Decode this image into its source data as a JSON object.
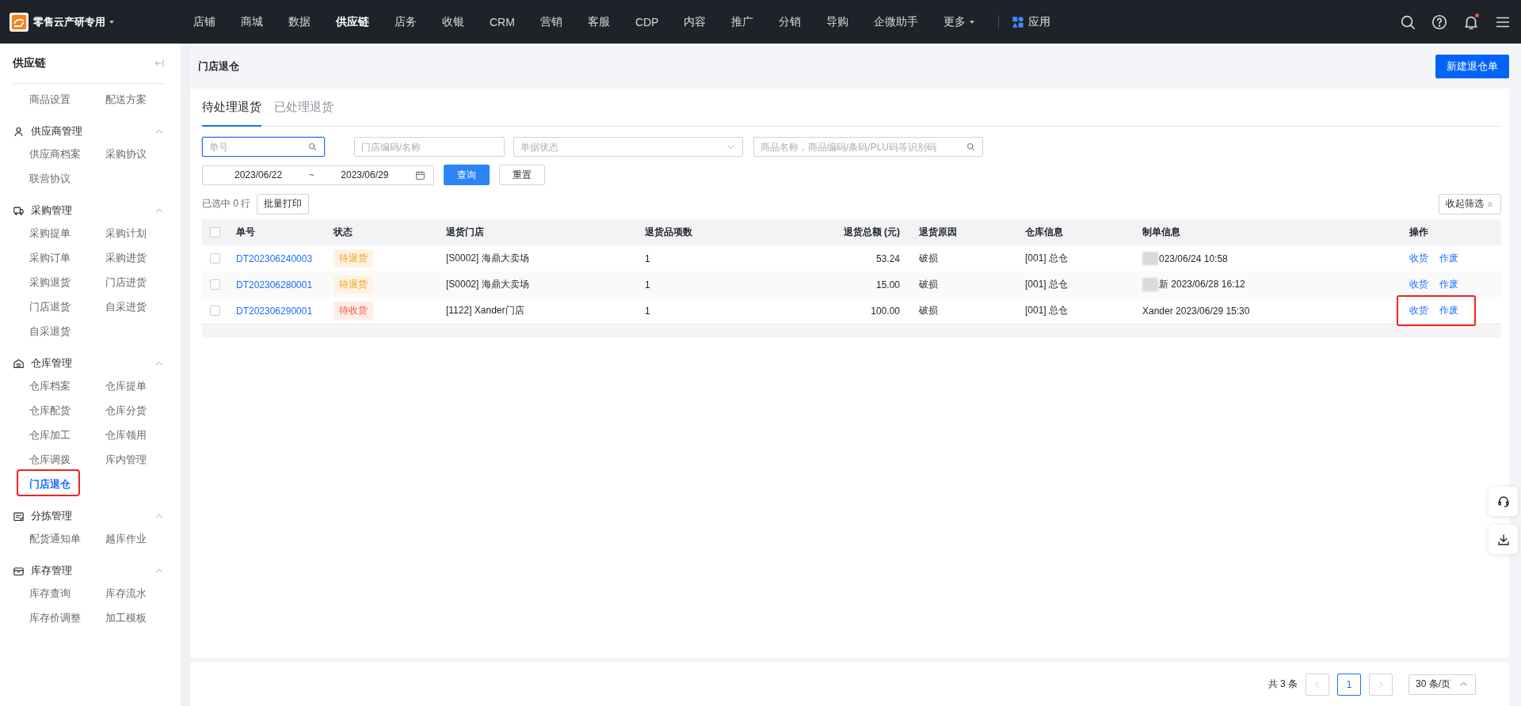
{
  "brand": {
    "name": "零售云产研专用"
  },
  "nav": [
    {
      "label": "店铺",
      "selected": false
    },
    {
      "label": "商城",
      "selected": false
    },
    {
      "label": "数据",
      "selected": false
    },
    {
      "label": "供应链",
      "selected": true
    },
    {
      "label": "店务",
      "selected": false
    },
    {
      "label": "收银",
      "selected": false
    },
    {
      "label": "CRM",
      "selected": false
    },
    {
      "label": "营销",
      "selected": false
    },
    {
      "label": "客服",
      "selected": false
    },
    {
      "label": "CDP",
      "selected": false
    },
    {
      "label": "内容",
      "selected": false
    },
    {
      "label": "推广",
      "selected": false
    },
    {
      "label": "分销",
      "selected": false
    },
    {
      "label": "导购",
      "selected": false
    },
    {
      "label": "企微助手",
      "selected": false
    },
    {
      "label": "更多",
      "selected": false,
      "kind": "menu"
    }
  ],
  "apps": {
    "label": "应用"
  },
  "notifications": {
    "unread": true
  },
  "sidebar": {
    "title": "供应链",
    "groups": [
      {
        "items": [
          {
            "label": "商品设置",
            "selected": false
          },
          {
            "label": "配送方案",
            "selected": false
          }
        ]
      },
      {
        "title": "供应商管理",
        "expanded": true,
        "items": [
          {
            "label": "供应商档案",
            "selected": false
          },
          {
            "label": "采购协议",
            "selected": false
          },
          {
            "label": "联营协议",
            "selected": false
          }
        ]
      },
      {
        "title": "采购管理",
        "expanded": true,
        "items": [
          {
            "label": "采购提单",
            "selected": false
          },
          {
            "label": "采购计划",
            "selected": false
          },
          {
            "label": "采购订单",
            "selected": false
          },
          {
            "label": "采购进货",
            "selected": false
          },
          {
            "label": "采购退货",
            "selected": false
          },
          {
            "label": "门店进货",
            "selected": false
          },
          {
            "label": "门店退货",
            "selected": false
          },
          {
            "label": "自采进货",
            "selected": false
          },
          {
            "label": "自采退货",
            "selected": false
          }
        ]
      },
      {
        "title": "仓库管理",
        "expanded": true,
        "items": [
          {
            "label": "仓库档案",
            "selected": false
          },
          {
            "label": "仓库提单",
            "selected": false
          },
          {
            "label": "仓库配货",
            "selected": false
          },
          {
            "label": "仓库分货",
            "selected": false
          },
          {
            "label": "仓库加工",
            "selected": false
          },
          {
            "label": "仓库领用",
            "selected": false
          },
          {
            "label": "仓库调拨",
            "selected": false
          },
          {
            "label": "库内管理",
            "selected": false
          },
          {
            "label": "门店退仓",
            "selected": true,
            "annotated": true
          }
        ]
      },
      {
        "title": "分拣管理",
        "expanded": true,
        "items": [
          {
            "label": "配货通知单",
            "selected": false
          },
          {
            "label": "越库作业",
            "selected": false
          }
        ]
      },
      {
        "title": "库存管理",
        "expanded": true,
        "items": [
          {
            "label": "库存查询",
            "selected": false
          },
          {
            "label": "库存流水",
            "selected": false
          },
          {
            "label": "库存价调整",
            "selected": false
          },
          {
            "label": "加工模板",
            "selected": false
          }
        ]
      }
    ]
  },
  "page": {
    "title": "门店退仓",
    "primary_button": "新建退仓单"
  },
  "tabs": [
    {
      "label": "待处理退货",
      "selected": true
    },
    {
      "label": "已处理退货",
      "selected": false
    }
  ],
  "filters": {
    "order_no": {
      "placeholder": "单号",
      "focused": true
    },
    "store": {
      "placeholder": "门店编码/名称"
    },
    "status": {
      "placeholder": "单据状态"
    },
    "product": {
      "placeholder": "商品名称，商品编码/条码/PLU码等识别码"
    },
    "date_from": "2023/06/22",
    "date_sep": "~",
    "date_to": "2023/06/29",
    "query": "查询",
    "reset": "重置"
  },
  "selection": {
    "prefix": "已选中",
    "count": "0",
    "suffix": "行",
    "batch_print": "批量打印",
    "collapse": "收起筛选"
  },
  "table": {
    "select_all": {
      "checked": false
    },
    "columns": [
      "单号",
      "状态",
      "退货门店",
      "退货品项数",
      "退货总额 (元)",
      "退货原因",
      "仓库信息",
      "制单信息",
      "操作"
    ],
    "rows": [
      {
        "selected": false,
        "order_no": "DT202306240003",
        "status": {
          "label": "待退货",
          "kind": "pending_return"
        },
        "store": "[S0002] 海鼎大卖场",
        "items": "1",
        "amount": "53.24",
        "reason": "破损",
        "warehouse": "[001] 总仓",
        "maker": {
          "text": "023/06/24 10:58",
          "redacted": true
        },
        "actions": [
          "收货",
          "作废"
        ],
        "annotated": false
      },
      {
        "selected": false,
        "order_no": "DT202306280001",
        "status": {
          "label": "待退货",
          "kind": "pending_return"
        },
        "store": "[S0002] 海鼎大卖场",
        "items": "1",
        "amount": "15.00",
        "reason": "破损",
        "warehouse": "[001] 总仓",
        "maker": {
          "text": "新 2023/06/28 16:12",
          "redacted": true
        },
        "actions": [
          "收货",
          "作废"
        ],
        "annotated": false
      },
      {
        "selected": false,
        "order_no": "DT202306290001",
        "status": {
          "label": "待收货",
          "kind": "pending_receipt"
        },
        "store": "[1122] Xander门店",
        "items": "1",
        "amount": "100.00",
        "reason": "破损",
        "warehouse": "[001] 总仓",
        "maker": {
          "text": "Xander 2023/06/29 15:30",
          "redacted": false
        },
        "actions": [
          "收货",
          "作废"
        ],
        "annotated": true
      }
    ]
  },
  "pagination": {
    "total": "共 3 条",
    "pages": [
      {
        "label": "1",
        "selected": true
      }
    ],
    "page_size": "30 条/页"
  }
}
